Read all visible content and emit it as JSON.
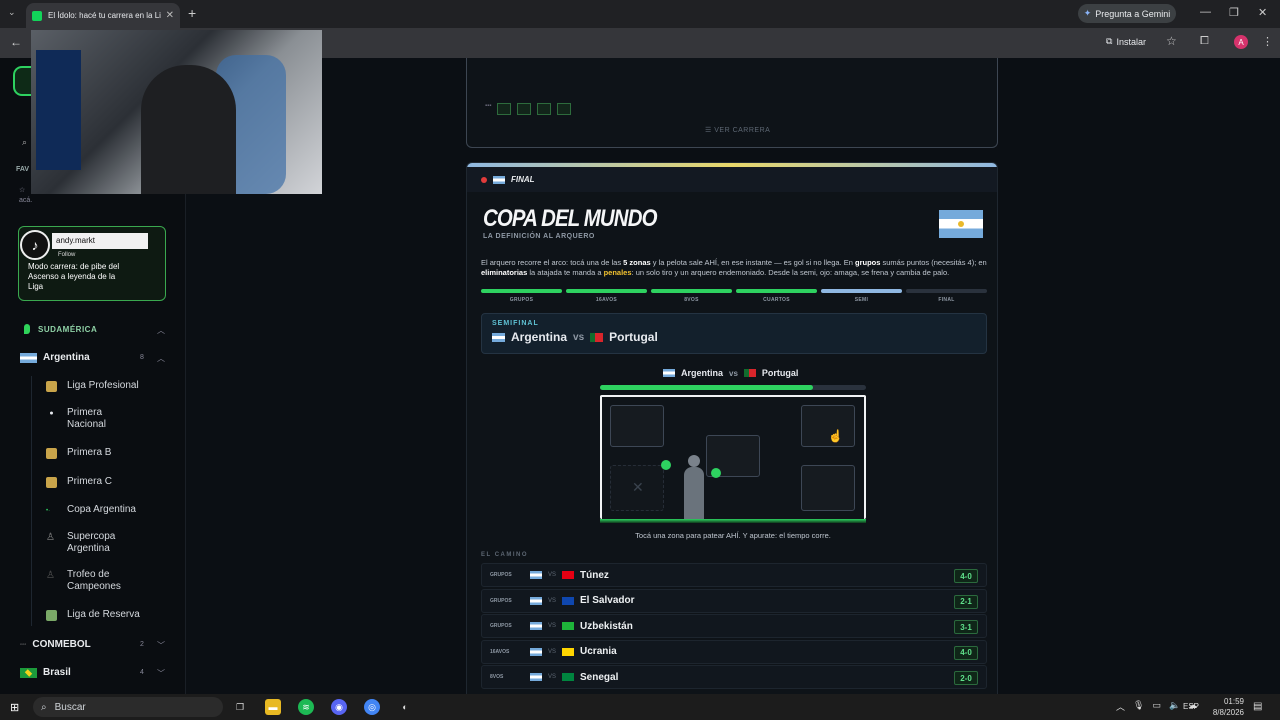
{
  "browser": {
    "tab_title": "El Ídolo: hacé tu carrera en la Li",
    "tab_close": "✕",
    "new_tab": "+",
    "gemini_label": "Pregunta a Gemini",
    "install_label": "Instalar",
    "avatar_letter": "A",
    "window_min": "—",
    "window_max": "❐",
    "window_close": "✕"
  },
  "sidebar": {
    "favs_label": "FAV",
    "aca_text": "acá.",
    "tiktok_user": "andy.markt",
    "tiktok_follow": "Follow",
    "promo_text": "Modo carrera: de pibe del Ascenso a leyenda de la Liga",
    "region": "SUDAMÉRICA",
    "countries": [
      {
        "name": "Argentina",
        "count": "8"
      },
      {
        "name": "CONMEBOL",
        "count": "2"
      },
      {
        "name": "Brasil",
        "count": "4"
      }
    ],
    "leagues": [
      {
        "label": "Liga Profesional",
        "icon": "shield-icon",
        "color": "#c9a44a"
      },
      {
        "label": "Primera Nacional",
        "icon": "dot-icon",
        "color": "#e6e9ee"
      },
      {
        "label": "Primera B",
        "icon": "shield-icon",
        "color": "#c9a44a"
      },
      {
        "label": "Primera C",
        "icon": "shield-icon",
        "color": "#c9a44a"
      },
      {
        "label": "Copa Argentina",
        "icon": "dots-icon",
        "color": "#2ed260"
      },
      {
        "label": "Supercopa Argentina",
        "icon": "trophy-icon",
        "color": "#888"
      },
      {
        "label": "Trofeo de Campeones",
        "icon": "trophy-icon",
        "color": "#555"
      },
      {
        "label": "Liga de Reserva",
        "icon": "shield-icon",
        "color": "#7aa867"
      }
    ]
  },
  "main": {
    "ver_carrera": "VER CARRERA",
    "final_tag": "FINAL",
    "title": "COPA DEL MUNDO",
    "subtitle": "LA DEFINICIÓN AL ARQUERO",
    "desc_1": "El arquero recorre el arco: tocá una de las ",
    "desc_b1": "5 zonas",
    "desc_2": " y la pelota sale AHÍ, en ese instante — es gol si no llega. En ",
    "desc_b2": "grupos",
    "desc_3": " sumás puntos (necesitás 4); en ",
    "desc_b3": "eliminatorias",
    "desc_4": " la atajada te manda a ",
    "desc_y": "penales",
    "desc_5": ": un solo tiro y un arquero endemoniado. Desde la semi, ojo: amaga, se frena y cambia de palo.",
    "stages": [
      {
        "label": "GRUPOS",
        "color": "#2ed260"
      },
      {
        "label": "16AVOS",
        "color": "#2ed260"
      },
      {
        "label": "8VOS",
        "color": "#2ed260"
      },
      {
        "label": "CUARTOS",
        "color": "#2ed260"
      },
      {
        "label": "SEMI",
        "color": "#8fb8e2"
      },
      {
        "label": "FINAL",
        "color": "#2a323d"
      }
    ],
    "semi_label": "SEMIFINAL",
    "team_home": "Argentina",
    "vs": "vs",
    "team_away": "Portugal",
    "timer_fraction": 0.8,
    "hint": "Tocá una zona para patear AHÍ. Y apurate: el tiempo corre.",
    "camino_label": "EL CAMINO",
    "path": [
      {
        "phase": "GRUPOS",
        "vs": "VS",
        "opponent": "Túnez",
        "score": "4-0",
        "flag": "#e70013"
      },
      {
        "phase": "GRUPOS",
        "vs": "VS",
        "opponent": "El Salvador",
        "score": "2-1",
        "flag": "#0f47af"
      },
      {
        "phase": "GRUPOS",
        "vs": "VS",
        "opponent": "Uzbekistán",
        "score": "3-1",
        "flag": "#1eb53a"
      },
      {
        "phase": "16AVOS",
        "vs": "VS",
        "opponent": "Ucrania",
        "score": "4-0",
        "flag": "#ffd500"
      },
      {
        "phase": "8VOS",
        "vs": "VS",
        "opponent": "Senegal",
        "score": "2-0",
        "flag": "#00853f"
      }
    ]
  },
  "taskbar": {
    "search_placeholder": "Buscar",
    "lang": "ESP",
    "time": "01:59",
    "date": "8/8/2026"
  }
}
